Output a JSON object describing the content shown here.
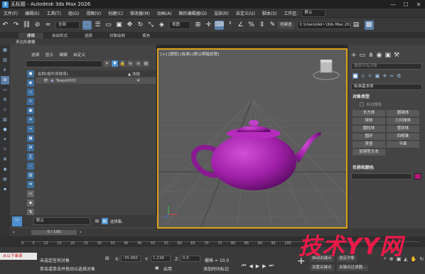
{
  "app": {
    "title": "无标题 - Autodesk 3ds Max 2026",
    "logo": "3"
  },
  "window_controls": [
    "—",
    "☐",
    "✕"
  ],
  "menu": {
    "items": [
      "文件(F)",
      "编辑(E)",
      "工具(T)",
      "组(G)",
      "视图(V)",
      "创建(C)",
      "修改器(M)",
      "动画(A)",
      "图形编辑器(D)",
      "渲染(R)",
      "自定义(U)",
      "脚本(S)",
      "工作区:"
    ],
    "workspace_value": "默认"
  },
  "toolbar": {
    "filter_combo": "全部",
    "view_combo": "视图",
    "named_sel_label": "创建选",
    "path_combo": "C:\\Users\\Ad~\\3ds Max 2026"
  },
  "ribbon": {
    "tabs": [
      "建模",
      "自由形式",
      "选择",
      "对象绘制",
      "填充"
    ],
    "active_tab": "建模",
    "sub_label": "多边形建模"
  },
  "explorer": {
    "menu": [
      "选择",
      "显示",
      "编辑",
      "自定义"
    ],
    "header_name": "名称(按升序排序)",
    "header_frozen": "▲ 冻结",
    "rows": [
      {
        "name": "Teapot001"
      }
    ]
  },
  "explorer_bottom": {
    "layer": "默认",
    "selection_set_label": "选择集:"
  },
  "viewport": {
    "label": "[+] [透视] [标准] [默认明暗处理]",
    "object_color": "#a020a8",
    "frame_color": "#e0a31a"
  },
  "command_panel": {
    "search_placeholder": "搜索所有对象",
    "category": "标准基本体",
    "object_type_header": "对象类型",
    "auto_grid": "自动栅格",
    "buttons": [
      "长方体",
      "圆锥体",
      "球体",
      "几何球体",
      "圆柱体",
      "管状体",
      "圆环",
      "四棱锥",
      "茶壶",
      "平面",
      "加强型文本"
    ],
    "name_color_header": "名称和颜色",
    "swatch_color": "#b5197a"
  },
  "timeline": {
    "position": "0 / 100",
    "ticks": [
      "0",
      "5",
      "10",
      "15",
      "20",
      "25",
      "30",
      "35",
      "40",
      "45",
      "50",
      "55",
      "60",
      "65",
      "70",
      "75",
      "80",
      "85",
      "90",
      "95",
      "100"
    ]
  },
  "status": {
    "listener": "从以下串读",
    "line1": "未选定任何对象",
    "line2": "单击或单击并拖动以选择对象",
    "x_label": "X:",
    "x_value": "-35.865",
    "y_label": "Y:",
    "y_value": "1.238",
    "z_label": "Z:",
    "z_value": "0.0",
    "grid_label": "栅格 = 10.0",
    "enable_label": "启用",
    "add_tag": "添加时间标记",
    "autokey": "自动关键点",
    "selected": "选定对象",
    "setkey": "设置关键点",
    "keyfilter": "关键点过滤器..."
  },
  "watermark": "技术YY网"
}
